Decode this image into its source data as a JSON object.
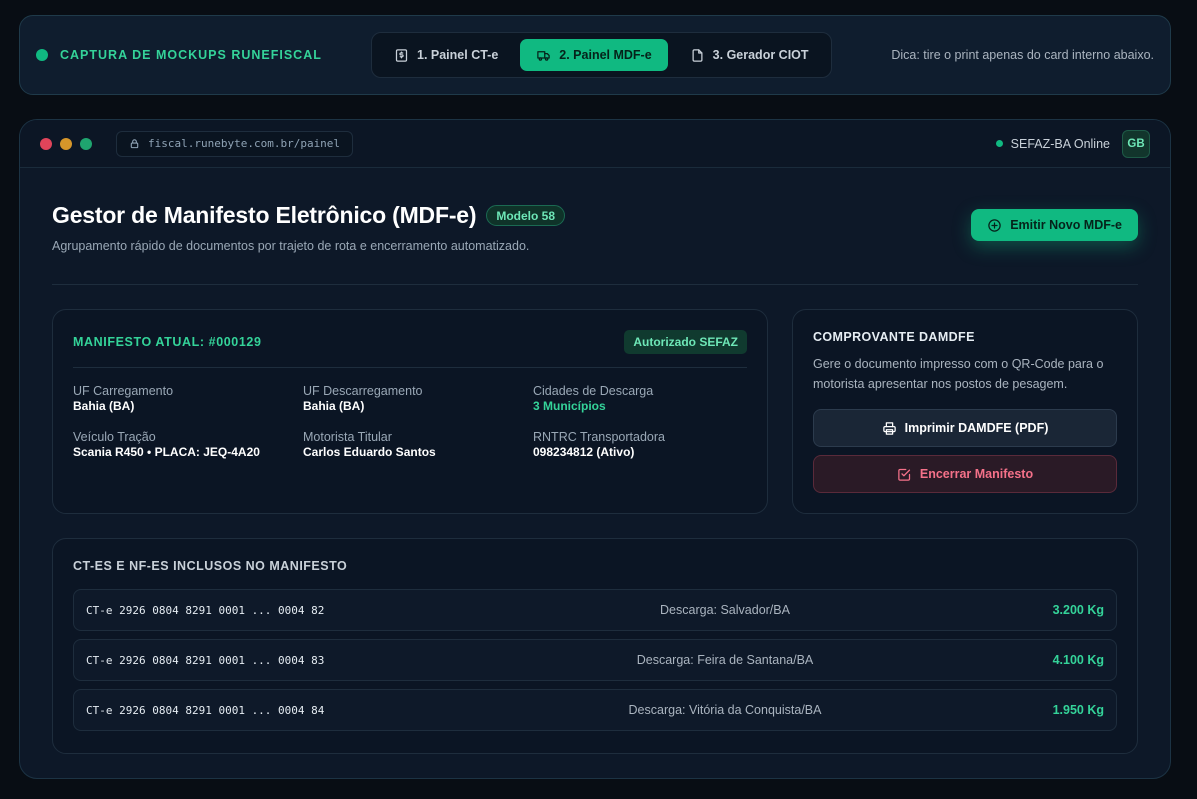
{
  "topbar": {
    "brand": "CAPTURA DE MOCKUPS RUNEFISCAL",
    "tabs": [
      {
        "label": "1. Painel CT-e",
        "icon": "receipt-icon",
        "active": false
      },
      {
        "label": "2. Painel MDF-e",
        "icon": "truck-icon",
        "active": true
      },
      {
        "label": "3. Gerador CIOT",
        "icon": "file-icon",
        "active": false
      }
    ],
    "tip": "Dica: tire o print apenas do card interno abaixo."
  },
  "window": {
    "url": "fiscal.runebyte.com.br/painel",
    "status": "SEFAZ-BA Online",
    "avatar": "GB",
    "lights": [
      "#e0445a",
      "#d6962a",
      "#1fa56f"
    ]
  },
  "page": {
    "title": "Gestor de Manifesto Eletrônico (MDF-e)",
    "model_badge": "Modelo 58",
    "subtitle": "Agrupamento rápido de documentos por trajeto de rota e encerramento automatizado.",
    "emit_button": "Emitir Novo MDF-e"
  },
  "manifest": {
    "title": "MANIFESTO ATUAL: #000129",
    "status_badge": "Autorizado SEFAZ",
    "fields": [
      {
        "label": "UF Carregamento",
        "value": "Bahia (BA)"
      },
      {
        "label": "UF Descarregamento",
        "value": "Bahia (BA)"
      },
      {
        "label": "Cidades de Descarga",
        "value": "3 Municípios"
      },
      {
        "label": "Veículo Tração",
        "value": "Scania R450 • PLACA: JEQ-4A20"
      },
      {
        "label": "Motorista Titular",
        "value": "Carlos Eduardo Santos"
      },
      {
        "label": "RNTRC Transportadora",
        "value": "098234812 (Ativo)"
      }
    ]
  },
  "damdfe": {
    "title": "COMPROVANTE DAMDFE",
    "description": "Gere o documento impresso com o QR-Code para o motorista apresentar nos postos de pesagem.",
    "print_button": "Imprimir DAMDFE (PDF)",
    "close_button": "Encerrar Manifesto"
  },
  "docs": {
    "title": "CT-ES E NF-ES INCLUSOS NO MANIFESTO",
    "rows": [
      {
        "key": "CT-e 2926 0804 8291 0001 ... 0004 82",
        "dest": "Descarga: Salvador/BA",
        "weight": "3.200 Kg"
      },
      {
        "key": "CT-e 2926 0804 8291 0001 ... 0004 83",
        "dest": "Descarga: Feira de Santana/BA",
        "weight": "4.100 Kg"
      },
      {
        "key": "CT-e 2926 0804 8291 0001 ... 0004 84",
        "dest": "Descarga: Vitória da Conquista/BA",
        "weight": "1.950 Kg"
      }
    ]
  },
  "colors": {
    "accent": "#10b981",
    "danger": "#f47189",
    "background": "#080d14"
  }
}
